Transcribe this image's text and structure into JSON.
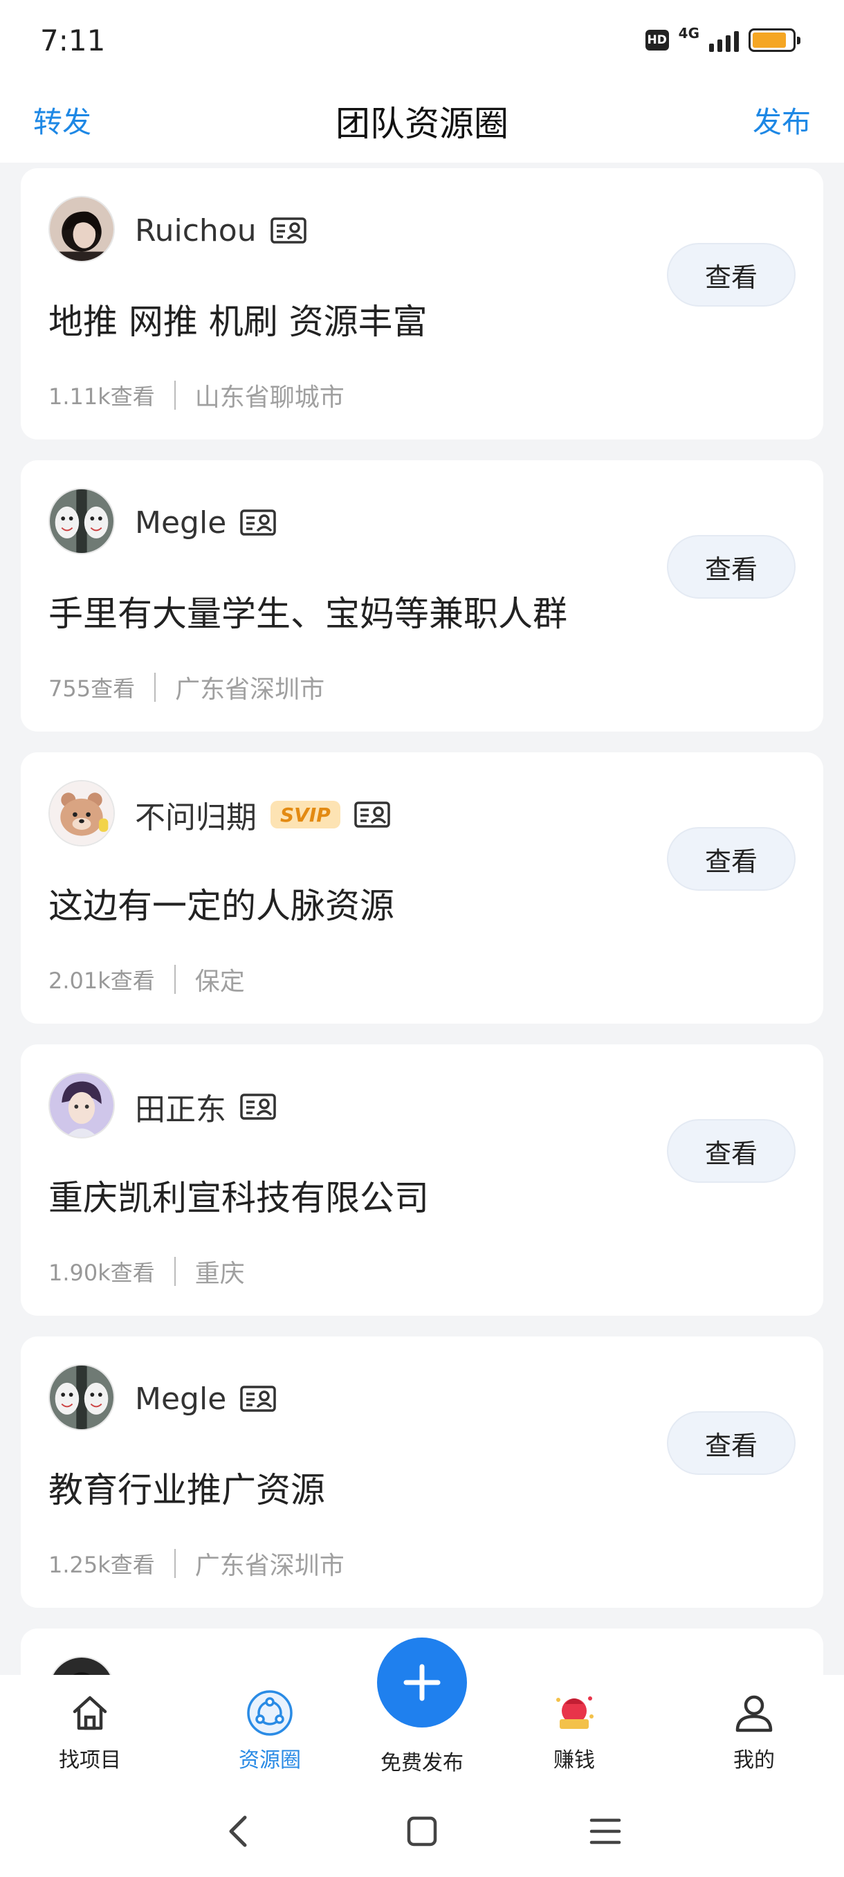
{
  "status_bar": {
    "time": "7:11",
    "hd": "HD",
    "network": "4G",
    "battery_level": 0.85,
    "battery_color": "#f5a623"
  },
  "header": {
    "left": "转发",
    "title": "团队资源圈",
    "right": "发布",
    "accent": "#1e88e5"
  },
  "feed": [
    {
      "name": "Ruichou",
      "svip": false,
      "title": "地推 网推 机刷 资源丰富",
      "views": "1.11k查看",
      "location": "山东省聊城市",
      "button": "查看",
      "avatar": "avatar-dark-hair"
    },
    {
      "name": "Megle",
      "svip": false,
      "title": "手里有大量学生、宝妈等兼职人群",
      "views": "755查看",
      "location": "广东省深圳市",
      "button": "查看",
      "avatar": "avatar-masks"
    },
    {
      "name": "不问归期",
      "svip": true,
      "svip_label": "SVIP",
      "title": "这边有一定的人脉资源",
      "views": "2.01k查看",
      "location": "保定",
      "button": "查看",
      "avatar": "avatar-bear"
    },
    {
      "name": "田正东",
      "svip": false,
      "title": "重庆凯利宣科技有限公司",
      "views": "1.90k查看",
      "location": "重庆",
      "button": "查看",
      "avatar": "avatar-anime-boy"
    },
    {
      "name": "Megle",
      "svip": false,
      "title": "教育行业推广资源",
      "views": "1.25k查看",
      "location": "广东省深圳市",
      "button": "查看",
      "avatar": "avatar-masks"
    }
  ],
  "bottom_nav": {
    "items": [
      {
        "label": "找项目",
        "icon": "home-icon",
        "active": false
      },
      {
        "label": "资源圈",
        "icon": "circle-network-icon",
        "active": true
      },
      {
        "label": "免费发布",
        "icon": "plus-icon",
        "active": false
      },
      {
        "label": "赚钱",
        "icon": "red-envelope-icon",
        "active": false
      },
      {
        "label": "我的",
        "icon": "user-icon",
        "active": false
      }
    ],
    "active_color": "#2a8be5",
    "fab_color": "#1f80ee"
  },
  "system_nav": [
    "back-icon",
    "home-square-icon",
    "menu-icon"
  ]
}
